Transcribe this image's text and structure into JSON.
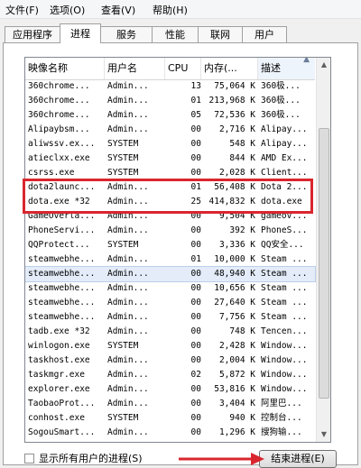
{
  "menubar": [
    "文件(F)",
    "选项(O)",
    "查看(V)",
    "帮助(H)"
  ],
  "tabs": [
    "应用程序",
    "进程",
    "服务",
    "性能",
    "联网",
    "用户"
  ],
  "active_tab_index": 1,
  "columns": [
    "映像名称",
    "用户名",
    "CPU",
    "内存(...",
    "描述"
  ],
  "sorted_column": "描述",
  "rows": [
    [
      "360chrome...",
      "Admin...",
      "13",
      "75,064 K",
      "360极..."
    ],
    [
      "360chrome...",
      "Admin...",
      "01",
      "213,968 K",
      "360极..."
    ],
    [
      "360chrome...",
      "Admin...",
      "05",
      "72,536 K",
      "360极..."
    ],
    [
      "Alipaybsm...",
      "Admin...",
      "00",
      "2,716 K",
      "Alipay..."
    ],
    [
      "aliwssv.ex...",
      "SYSTEM",
      "00",
      "548 K",
      "Alipay..."
    ],
    [
      "atieclxx.exe",
      "SYSTEM",
      "00",
      "844 K",
      "AMD Ex..."
    ],
    [
      "csrss.exe",
      "SYSTEM",
      "00",
      "2,028 K",
      "Client..."
    ],
    [
      "dota2launc...",
      "Admin...",
      "01",
      "56,408 K",
      "Dota 2..."
    ],
    [
      "dota.exe *32",
      "Admin...",
      "25",
      "414,832 K",
      "dota.exe"
    ],
    [
      "GameOverla...",
      "Admin...",
      "00",
      "9,504 K",
      "gameov..."
    ],
    [
      "PhoneServi...",
      "Admin...",
      "00",
      "392 K",
      "PhoneS..."
    ],
    [
      "QQProtect...",
      "SYSTEM",
      "00",
      "3,336 K",
      "QQ安全..."
    ],
    [
      "steamwebhe...",
      "Admin...",
      "01",
      "10,000 K",
      "Steam ..."
    ],
    [
      "steamwebhe...",
      "Admin...",
      "00",
      "48,940 K",
      "Steam ..."
    ],
    [
      "steamwebhe...",
      "Admin...",
      "00",
      "10,656 K",
      "Steam ..."
    ],
    [
      "steamwebhe...",
      "Admin...",
      "00",
      "27,640 K",
      "Steam ..."
    ],
    [
      "steamwebhe...",
      "Admin...",
      "00",
      "7,756 K",
      "Steam ..."
    ],
    [
      "tadb.exe *32",
      "Admin...",
      "00",
      "748 K",
      "Tencen..."
    ],
    [
      "winlogon.exe",
      "SYSTEM",
      "00",
      "2,428 K",
      "Window..."
    ],
    [
      "taskhost.exe",
      "Admin...",
      "00",
      "2,004 K",
      "Window..."
    ],
    [
      "taskmgr.exe",
      "Admin...",
      "02",
      "5,872 K",
      "Window..."
    ],
    [
      "explorer.exe",
      "Admin...",
      "00",
      "53,816 K",
      "Window..."
    ],
    [
      "TaobaoProt...",
      "Admin...",
      "00",
      "3,404 K",
      "阿里巴..."
    ],
    [
      "conhost.exe",
      "SYSTEM",
      "00",
      "940 K",
      "控制台..."
    ],
    [
      "SogouSmart...",
      "Admin...",
      "00",
      "1,296 K",
      "搜狗输..."
    ]
  ],
  "selected_row_index": 13,
  "show_all_users_label": "显示所有用户的进程(S)",
  "show_all_users_checked": false,
  "end_process_label": "结束进程(E)",
  "colors": {
    "highlight": "#d9262e",
    "selection": "#e3ecf8"
  }
}
